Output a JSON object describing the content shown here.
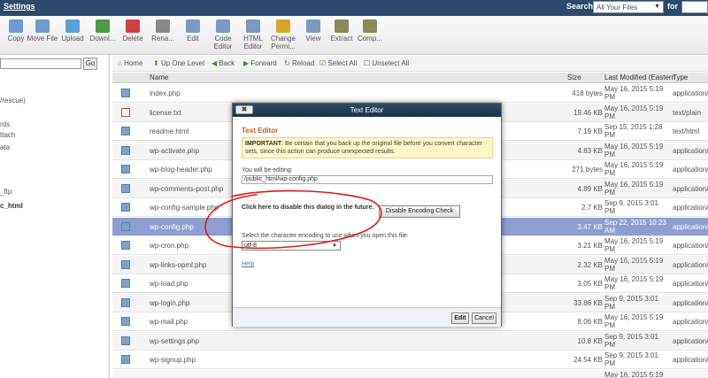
{
  "topbar": {
    "settings": "Settings",
    "search_label": "Search",
    "search_scope": "All Your Files",
    "for_label": "for"
  },
  "toolbar": [
    {
      "label": "Copy",
      "icon": "copy-icon",
      "color": "#6e9ccc"
    },
    {
      "label": "Move File",
      "icon": "move-icon",
      "color": "#6e9ccc"
    },
    {
      "label": "Upload",
      "icon": "upload-icon",
      "color": "#5aa0d8"
    },
    {
      "label": "Downl...",
      "icon": "download-icon",
      "color": "#4a9a4a"
    },
    {
      "label": "Delete",
      "icon": "delete-icon",
      "color": "#d04040"
    },
    {
      "label": "Rena...",
      "icon": "rename-icon",
      "color": "#888888"
    },
    {
      "label": "Edit",
      "icon": "edit-icon",
      "color": "#7a9ac0"
    },
    {
      "label": "Code Editor",
      "icon": "code-editor-icon",
      "color": "#7a9ac0"
    },
    {
      "label": "HTML Editor",
      "icon": "html-editor-icon",
      "color": "#7a9ac0"
    },
    {
      "label": "Change Permi...",
      "icon": "key-icon",
      "color": "#d4a82a"
    },
    {
      "label": "View",
      "icon": "view-icon",
      "color": "#7a9ac0"
    },
    {
      "label": "Extract",
      "icon": "extract-icon",
      "color": "#8a8a5a"
    },
    {
      "label": "Comp...",
      "icon": "compress-icon",
      "color": "#8a8a5a"
    }
  ],
  "tree": {
    "go": "Go",
    "items": [
      "/rescue)",
      "rds",
      "ttach",
      "ata",
      "_ftp",
      "c_html"
    ]
  },
  "nav": {
    "home": "Home",
    "up": "Up One Level",
    "back": "Back",
    "forward": "Forward",
    "reload": "Reload",
    "select_all": "Select All",
    "unselect_all": "Unselect All"
  },
  "columns": {
    "name": "Name",
    "size": "Size",
    "modified": "Last Modified (Eastern",
    "type": "Type"
  },
  "files": [
    {
      "name": "index.php",
      "size": "418 bytes",
      "date": "May 16, 2015 5:19 PM",
      "type": "application/"
    },
    {
      "name": "license.txt",
      "size": "19.46 KB",
      "date": "May 16, 2015 5:19 PM",
      "type": "text/plain"
    },
    {
      "name": "readme.html",
      "size": "7.19 KB",
      "date": "Sep 15, 2015 1:28 PM",
      "type": "text/html"
    },
    {
      "name": "wp-activate.php",
      "size": "4.83 KB",
      "date": "May 16, 2015 5:19 PM",
      "type": "application/"
    },
    {
      "name": "wp-blog-header.php",
      "size": "271 bytes",
      "date": "May 16, 2015 5:19 PM",
      "type": "application/"
    },
    {
      "name": "wp-comments-post.php",
      "size": "4.89 KB",
      "date": "May 16, 2015 5:19 PM",
      "type": "application/"
    },
    {
      "name": "wp-config-sample.php",
      "size": "2.7 KB",
      "date": "Sep 9, 2015 3:01 PM",
      "type": "application/"
    },
    {
      "name": "wp-config.php",
      "size": "3.47 KB",
      "date": "Sep 22, 2015 10:23 AM",
      "type": "application/"
    },
    {
      "name": "wp-cron.php",
      "size": "3.21 KB",
      "date": "May 16, 2015 5:19 PM",
      "type": "application/"
    },
    {
      "name": "wp-links-opml.php",
      "size": "2.32 KB",
      "date": "May 16, 2015 5:19 PM",
      "type": "application/"
    },
    {
      "name": "wp-load.php",
      "size": "3.05 KB",
      "date": "May 16, 2015 5:19 PM",
      "type": "application/"
    },
    {
      "name": "wp-login.php",
      "size": "33.86 KB",
      "date": "Sep 9, 2015 3:01 PM",
      "type": "application/"
    },
    {
      "name": "wp-mail.php",
      "size": "8.06 KB",
      "date": "May 16, 2015 5:19 PM",
      "type": "application/"
    },
    {
      "name": "wp-settings.php",
      "size": "10.8 KB",
      "date": "Sep 9, 2015 3:01 PM",
      "type": "application/"
    },
    {
      "name": "wp-signup.php",
      "size": "24.54 KB",
      "date": "Sep 9, 2015 3:01 PM",
      "type": "application/"
    },
    {
      "name": "",
      "size": "",
      "date": "May 16, 2015 5:19",
      "type": ""
    }
  ],
  "dialog": {
    "title": "Text Editor",
    "close": "✖",
    "heading": "Text Editor",
    "warn_bold": "IMPORTANT",
    "warn_text": ": Be certain that you back up the original file before you convert character sets, since this action can produce unexpected results.",
    "editing_label": "You will be editing:",
    "editing_path": "/public_html/wp-config.php",
    "disable_text": "Click here to disable this dialog in the future.",
    "disable_button": "Disable Encoding Check",
    "encoding_label": "Select the character encoding to use when you open this file:",
    "encoding_value": "utf-8",
    "help": "Help",
    "edit_button": "Edit",
    "cancel_button": "Cancel"
  },
  "colors": {
    "topbar": "#2c4a6b",
    "selected_row": "#8f9ed1",
    "annotation": "#e01818"
  }
}
